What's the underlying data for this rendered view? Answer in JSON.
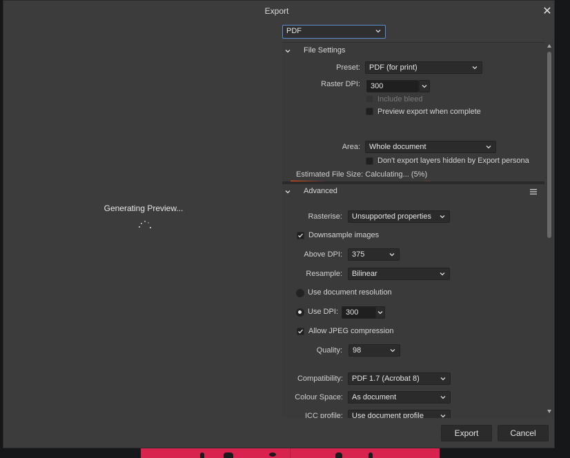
{
  "window": {
    "title": "Export"
  },
  "preview": {
    "status_text": "Generating Preview..."
  },
  "format": {
    "selected": "PDF"
  },
  "file_settings": {
    "header": "File Settings",
    "preset_label": "Preset:",
    "preset_value": "PDF (for print)",
    "raster_dpi_label": "Raster DPI:",
    "raster_dpi_value": "300",
    "include_bleed_label": "Include bleed",
    "include_bleed_checked": false,
    "preview_export_label": "Preview export when complete",
    "preview_export_checked": false,
    "area_label": "Area:",
    "area_value": "Whole document",
    "dont_export_hidden_label": "Don't export layers hidden by Export persona",
    "dont_export_hidden_checked": false,
    "estimated_size_text": "Estimated File Size: Calculating... (5%)"
  },
  "advanced": {
    "header": "Advanced",
    "rasterise_label": "Rasterise:",
    "rasterise_value": "Unsupported properties",
    "downsample_label": "Downsample images",
    "downsample_checked": true,
    "above_dpi_label": "Above DPI:",
    "above_dpi_value": "375",
    "resample_label": "Resample:",
    "resample_value": "Bilinear",
    "use_doc_res_label": "Use document resolution",
    "use_dpi_label": "Use DPI:",
    "use_dpi_value": "300",
    "allow_jpeg_label": "Allow JPEG compression",
    "allow_jpeg_checked": true,
    "quality_label": "Quality:",
    "quality_value": "98",
    "compatibility_label": "Compatibility:",
    "compatibility_value": "PDF 1.7 (Acrobat 8)",
    "colour_space_label": "Colour Space:",
    "colour_space_value": "As document",
    "icc_profile_label": "ICC profile:",
    "icc_profile_value": "Use document profile"
  },
  "buttons": {
    "export": "Export",
    "cancel": "Cancel"
  },
  "colors": {
    "accent_underline": "#e8501a",
    "focus_border": "#5d8ccf",
    "background_artwork": "#d8234e"
  }
}
